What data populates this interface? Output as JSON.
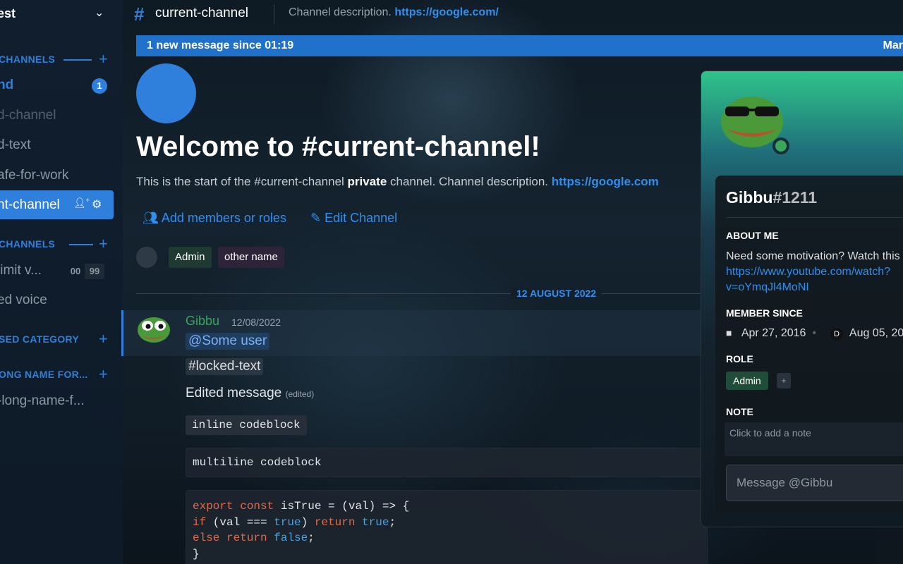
{
  "server": {
    "name": "est"
  },
  "sidebar": {
    "categories": [
      {
        "label": "CHANNELS"
      },
      {
        "label": "CHANNELS"
      },
      {
        "label": "SED CATEGORY"
      },
      {
        "label": "ONG NAME FOR..."
      }
    ],
    "channels": [
      {
        "label": "nd",
        "badge": "1"
      },
      {
        "label": "d-channel"
      },
      {
        "label": "d-text"
      },
      {
        "label": "afe-for-work"
      },
      {
        "label": "nt-channel"
      },
      {
        "label": "limit v..."
      },
      {
        "label": "ed voice"
      },
      {
        "label": "-long-name-f..."
      }
    ],
    "voice_counts": [
      "00",
      "99"
    ]
  },
  "header": {
    "channel": "current-channel",
    "description": "Channel description.",
    "link": "https://google.com/"
  },
  "new_messages": {
    "text": "1 new message since 01:19",
    "mark": "Mar"
  },
  "welcome": {
    "title": "Welcome to #current-channel!",
    "sub_pre": "This is the start of the #current-channel ",
    "sub_bold": "private",
    "sub_post": " channel. Channel description. ",
    "sub_link": "https://google.com",
    "add_members": "Add members or roles",
    "edit_channel": "Edit Channel",
    "tags": [
      "Admin",
      "other name"
    ]
  },
  "date_divider": "12 AUGUST 2022",
  "message": {
    "author": "Gibbu",
    "timestamp": "12/08/2022",
    "mention": "@Some user",
    "channel_mention": "#locked-text",
    "edited_text": "Edited message",
    "edited_tag": "(edited)",
    "inline_code": "inline codeblock",
    "multiline_code": "multiline codeblock"
  },
  "profile": {
    "username": "Gibbu",
    "discriminator": "#1211",
    "about_title": "ABOUT ME",
    "about_text": "Need some motivation? Watch this",
    "about_link": "https://www.youtube.com/watch?v=oYmqJl4MoNI",
    "member_since_title": "MEMBER SINCE",
    "discord_since": "Apr 27, 2016",
    "server_since": "Aug 05, 20",
    "role_title": "ROLE",
    "role": "Admin",
    "role_add": "+",
    "note_title": "NOTE",
    "note_placeholder": "Click to add a note",
    "message_placeholder": "Message @Gibbu"
  },
  "colors": {
    "accent": "#2f7fdc",
    "online": "#3ba55c",
    "author": "#3ba55c"
  }
}
